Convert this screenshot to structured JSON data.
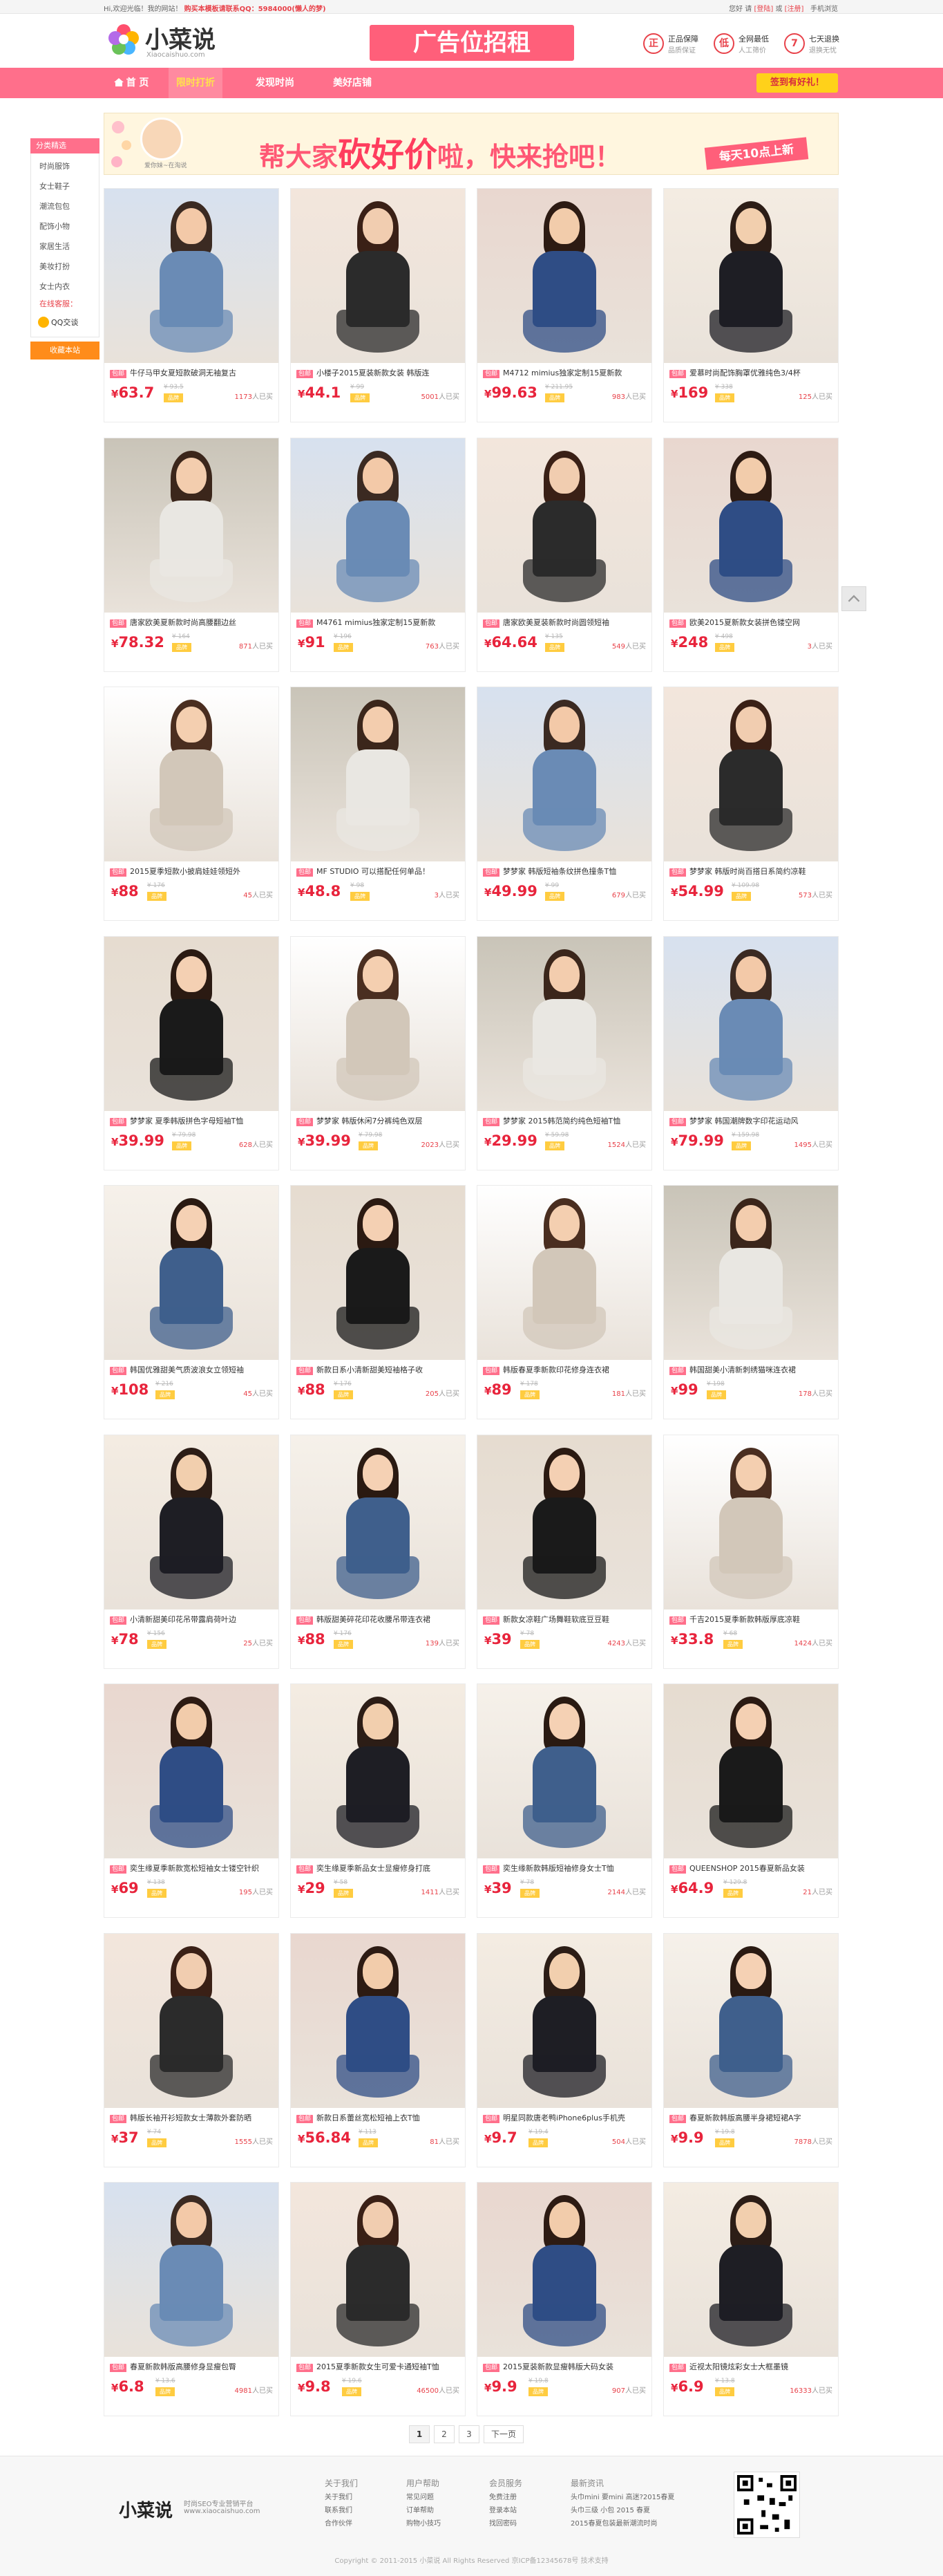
{
  "topbar": {
    "welcome": "Hi,欢迎光临！我的网站！",
    "promo": "购买本模板请联系QQ：5984000(懒人的梦)",
    "greeting": "您好 请",
    "login": "[登陆]",
    "or": "或",
    "register": "[注册]",
    "mobile": "手机浏览"
  },
  "header": {
    "logo_text": "小菜说",
    "logo_sub": "Xiaocaishuo.com",
    "ad_text": "广告位招租",
    "guarantees": [
      {
        "icon": "正",
        "t1": "正品保障",
        "t2": "品质保证"
      },
      {
        "icon": "低",
        "t1": "全网最低",
        "t2": "人工筛价"
      },
      {
        "icon": "7",
        "t1": "七天退换",
        "t2": "退换无忧"
      }
    ]
  },
  "nav": {
    "items": [
      {
        "label": "首 页"
      },
      {
        "label": "限时打折"
      },
      {
        "label": "发现时尚"
      },
      {
        "label": "美好店铺"
      }
    ],
    "signin": "签到有好礼！"
  },
  "sidebar": {
    "head": "分类精选",
    "items": [
      "时尚服饰",
      "女士鞋子",
      "潮流包包",
      "配饰小物",
      "家居生活",
      "美妆打扮",
      "女士内衣"
    ],
    "service": "在线客服：",
    "qq": "QQ交谈",
    "fav": "收藏本站"
  },
  "promo": {
    "avatar_label": "爱你妹~在淘说",
    "text_a": "帮大家",
    "text_b": "砍好价",
    "text_c": "啦，快来抢吧！",
    "tag": "每天10点上新"
  },
  "badge_label": "品牌",
  "tag_label": "包邮",
  "sold_suffix": "人已买",
  "products": [
    {
      "title": "牛仔马甲女夏短款破洞无袖复古",
      "price": "63.7",
      "old": "¥ 93.5",
      "sold": "1173"
    },
    {
      "title": "小楼子2015夏装新款女装 韩版连",
      "price": "44.1",
      "old": "¥ 99",
      "sold": "5001"
    },
    {
      "title": "M4712 mimius独家定制15夏新款",
      "price": "99.63",
      "old": "¥ 211.95",
      "sold": "983"
    },
    {
      "title": "爱慕时尚配饰胸罩优雅纯色3/4杯",
      "price": "169",
      "old": "¥ 338",
      "sold": "125"
    },
    {
      "title": "唐家欧美夏新款时尚高腰翻边丝",
      "price": "78.32",
      "old": "¥ 164",
      "sold": "871"
    },
    {
      "title": "M4761 mimius独家定制15夏新款",
      "price": "91",
      "old": "¥ 196",
      "sold": "763"
    },
    {
      "title": "唐家欧美夏装新款时尚圆领短袖",
      "price": "64.64",
      "old": "¥ 135",
      "sold": "549"
    },
    {
      "title": "欧美2015夏新款女装拼色镂空网",
      "price": "248",
      "old": "¥ 498",
      "sold": "3"
    },
    {
      "title": "2015夏季短款小披肩娃娃领短外",
      "price": "88",
      "old": "¥ 176",
      "sold": "45"
    },
    {
      "title": "MF STUDIO 可以搭配任何单品！",
      "price": "48.8",
      "old": "¥ 98",
      "sold": "3"
    },
    {
      "title": "梦梦家 韩版短袖条纹拼色撞条T恤",
      "price": "49.99",
      "old": "¥ 99",
      "sold": "679"
    },
    {
      "title": "梦梦家 韩版时尚百搭日系简约凉鞋",
      "price": "54.99",
      "old": "¥ 109.98",
      "sold": "573"
    },
    {
      "title": "梦梦家 夏季韩版拼色字母短袖T恤",
      "price": "39.99",
      "old": "¥ 79.98",
      "sold": "628"
    },
    {
      "title": "梦梦家 韩版休闲7分裤纯色双层",
      "price": "39.99",
      "old": "¥ 79.98",
      "sold": "2023"
    },
    {
      "title": "梦梦家 2015韩范简约纯色短袖T恤",
      "price": "29.99",
      "old": "¥ 59.98",
      "sold": "1524"
    },
    {
      "title": "梦梦家 韩国潮牌数字印花运动风",
      "price": "79.99",
      "old": "¥ 159.98",
      "sold": "1495"
    },
    {
      "title": "韩国优雅甜美气质波浪女立领短袖",
      "price": "108",
      "old": "¥ 216",
      "sold": "45"
    },
    {
      "title": "新款日系小清新甜美短袖格子收",
      "price": "88",
      "old": "¥ 176",
      "sold": "205"
    },
    {
      "title": "韩版春夏季新款印花修身连衣裙",
      "price": "89",
      "old": "¥ 178",
      "sold": "181"
    },
    {
      "title": "韩国甜美小清新刺绣猫咪连衣裙",
      "price": "99",
      "old": "¥ 198",
      "sold": "178"
    },
    {
      "title": "小清新甜美印花吊带露肩荷叶边",
      "price": "78",
      "old": "¥ 156",
      "sold": "25"
    },
    {
      "title": "韩版甜美碎花印花收腰吊带连衣裙",
      "price": "88",
      "old": "¥ 176",
      "sold": "139"
    },
    {
      "title": "新款女凉鞋广场舞鞋软底豆豆鞋",
      "price": "39",
      "old": "¥ 78",
      "sold": "4243"
    },
    {
      "title": "千吉2015夏季新款韩版厚底凉鞋",
      "price": "33.8",
      "old": "¥ 68",
      "sold": "1424"
    },
    {
      "title": "奕生缘夏季新款宽松短袖女士镂空针织",
      "price": "69",
      "old": "¥ 138",
      "sold": "195"
    },
    {
      "title": "奕生缘夏季新品女士显瘦修身打底",
      "price": "29",
      "old": "¥ 58",
      "sold": "1411"
    },
    {
      "title": "奕生缘新款韩版短袖修身女士T恤",
      "price": "39",
      "old": "¥ 78",
      "sold": "2144"
    },
    {
      "title": "QUEENSHOP 2015春夏新品女装",
      "price": "64.9",
      "old": "¥ 129.8",
      "sold": "21"
    },
    {
      "title": "韩版长袖开衫短款女士薄款外套防晒",
      "price": "37",
      "old": "¥ 74",
      "sold": "1555"
    },
    {
      "title": "新款日系蕾丝宽松短袖上衣T恤",
      "price": "56.84",
      "old": "¥ 113",
      "sold": "81"
    },
    {
      "title": "明星同款唐老鸭iPhone6plus手机壳",
      "price": "9.7",
      "old": "¥ 19.4",
      "sold": "504"
    },
    {
      "title": "春夏新款韩版高腰半身裙短裙A字",
      "price": "9.9",
      "old": "¥ 19.8",
      "sold": "7878"
    },
    {
      "title": "春夏新款韩版高腰修身显瘦包臀",
      "price": "6.8",
      "old": "¥ 13.6",
      "sold": "4981"
    },
    {
      "title": "2015夏季新款女生可爱卡通短袖T恤",
      "price": "9.8",
      "old": "¥ 19.6",
      "sold": "46500"
    },
    {
      "title": "2015夏装新款显瘦韩版大码女装",
      "price": "9.9",
      "old": "¥ 19.8",
      "sold": "907"
    },
    {
      "title": "近视太阳镜炫彩女士大框墨镜",
      "price": "6.9",
      "old": "¥ 13.8",
      "sold": "16333"
    }
  ],
  "pager": {
    "pages": [
      "1",
      "2",
      "3"
    ],
    "next": "下一页"
  },
  "footer": {
    "logo": "小菜说",
    "sub1": "时尚SEO专业营销平台",
    "sub2": "www.xiaocaishuo.com",
    "cols": [
      {
        "title": "关于我们",
        "links": [
          "关于我们",
          "联系我们",
          "合作伙伴"
        ]
      },
      {
        "title": "用户帮助",
        "links": [
          "常见问题",
          "订单帮助",
          "购物小技巧"
        ]
      },
      {
        "title": "会员服务",
        "links": [
          "免费注册",
          "登录本站",
          "找回密码"
        ]
      },
      {
        "title": "最新资讯",
        "links": [
          "头巾mini 要mini 高迷?2015春夏",
          "头巾三级 小包 2015 春夏",
          "2015春夏包装最新潮流时尚"
        ]
      }
    ],
    "copyright": "Copyright © 2011-2015 小菜说 All Rights Reserved 京ICP备12345678号 技术支持"
  },
  "colors": {
    "brand": "#ff6f8b",
    "price": "#e8243c",
    "signin": "#ffd11a"
  },
  "icons": {
    "logo": "flower-logo-icon",
    "home": "home-icon",
    "backtop": "chevron-up-icon",
    "qq": "qq-icon",
    "qr": "qr-code-icon"
  }
}
